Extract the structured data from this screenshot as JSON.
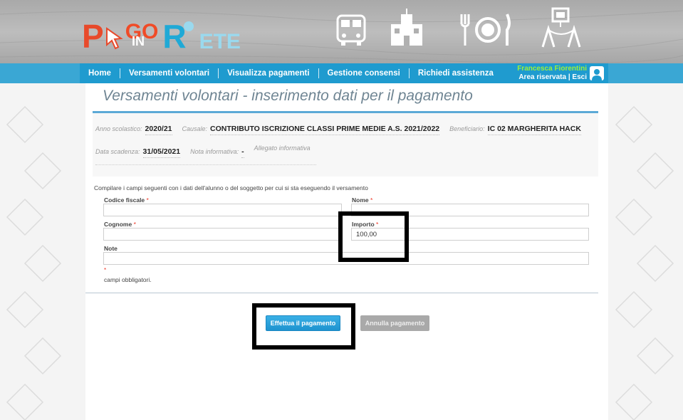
{
  "logo": {
    "p": "P",
    "go": "GO",
    "in": "IN",
    "r": "R",
    "ete": "ETE"
  },
  "nav": {
    "items": [
      {
        "label": "Home"
      },
      {
        "label": "Versamenti volontari"
      },
      {
        "label": "Visualizza pagamenti"
      },
      {
        "label": "Gestione consensi"
      },
      {
        "label": "Richiedi assistenza"
      }
    ],
    "user_name": "Francesca Fiorentini",
    "area_riservata": "Area riservata",
    "separator": "|",
    "esci": "Esci"
  },
  "page": {
    "title": "Versamenti volontari - inserimento dati per il pagamento"
  },
  "info": {
    "anno_label": "Anno scolastico:",
    "anno_value": "2020/21",
    "causale_label": "Causale:",
    "causale_value": "CONTRIBUTO ISCRIZIONE CLASSI PRIME MEDIE A.S. 2021/2022",
    "beneficiario_label": "Beneficiario:",
    "beneficiario_value": "IC 02 MARGHERITA HACK",
    "scadenza_label": "Data scadenza:",
    "scadenza_value": "31/05/2021",
    "nota_label": "Nota informativa:",
    "nota_value": "-",
    "allegato_link": "Allegato informativa"
  },
  "form": {
    "instruction": "Compilare i campi seguenti con i dati dell'alunno o del soggetto per cui si sta eseguendo il versamento",
    "codice_fiscale_label": "Codice fiscale",
    "nome_label": "Nome",
    "cognome_label": "Cognome",
    "importo_label": "Importo",
    "importo_value": "100,00",
    "note_label": "Note",
    "required_marker": "*",
    "required_note": "campi obbligatori."
  },
  "buttons": {
    "pay": "Effettua il pagamento",
    "cancel": "Annulla pagamento"
  },
  "colors": {
    "nav_blue": "#1f9bcf",
    "title_color": "#6f8593",
    "user_green": "#9bf03a",
    "highlight": "#000000"
  }
}
